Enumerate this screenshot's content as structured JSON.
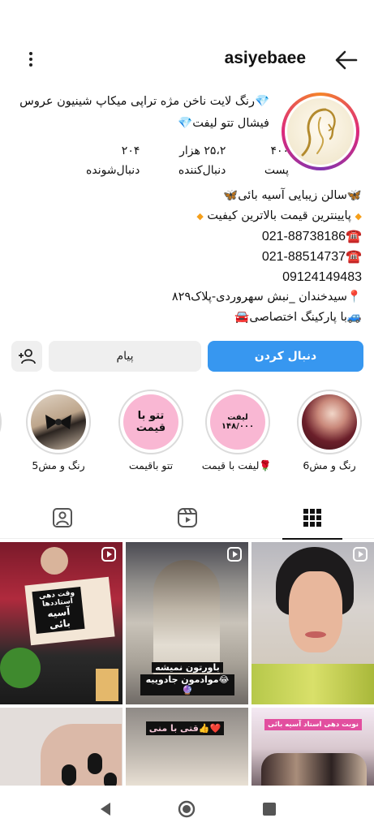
{
  "header": {
    "username": "asiyebaee"
  },
  "profile": {
    "bio_top_line1": "💎رنگ لایت ناخن مژه تراپی میکاپ شینیون عروس",
    "bio_top_line2": "فیشال تتو لیفت💎",
    "stats": [
      {
        "value": "۴۰۰",
        "label": "پست"
      },
      {
        "value": "۲۵،۲ هزار",
        "label": "دنبال‌کننده"
      },
      {
        "value": "۲۰۴",
        "label": "دنبال‌شونده"
      }
    ],
    "bio_lines": [
      "🦋سالن زیبایی آسیه بائی🦋",
      "پایینترین قیمت بالاترین کیفیت",
      "☎️021-88738186",
      "☎️021-88514737",
      "09124149483",
      "📍سیدخندان _نبش سهروردی-پلاک۸۲۹",
      "🚙با پارکینگ اختصاصی🚘"
    ]
  },
  "actions": {
    "follow_label": "دنبال کردن",
    "message_label": "پیام"
  },
  "highlights": [
    {
      "label": "رنگ و مش6",
      "image_text": ""
    },
    {
      "label": "🌹لیفت با قیمت",
      "image_text": "لیفت ۱۴۸/۰۰۰"
    },
    {
      "label": "تتو باقیمت",
      "image_text": "تتو با قیمت"
    },
    {
      "label": "رنگ و مش5",
      "image_text": ""
    }
  ],
  "posts": [
    {
      "caption_1": "وقت دهی استاددها",
      "caption_2": "آسیه بائی"
    },
    {
      "caption_1": "باورتون نمیشه",
      "caption_2": "😂مواد‌مون جادوییه🔮"
    },
    {
      "caption_1": ""
    },
    {
      "caption_1": ""
    },
    {
      "caption_1": "❤️👍قتی با منی"
    },
    {
      "caption_1": "نوبت دهی استاد آسیه بائی"
    }
  ],
  "colors": {
    "follow_button": "#3797f0",
    "secondary_button": "#efefef",
    "story_ring_start": "#f58529",
    "story_ring_end": "#8134af",
    "highlight_pink": "#f9b7d3"
  },
  "icons": {
    "menu": "more-vertical-icon",
    "back": "arrow-left-icon",
    "add_person": "add-person-icon",
    "tab_tagged": "tagged-icon",
    "tab_reels": "reels-icon",
    "tab_grid": "grid-icon",
    "nav_back": "triangle-back-icon",
    "nav_home": "circle-home-icon",
    "nav_recents": "square-recents-icon"
  }
}
